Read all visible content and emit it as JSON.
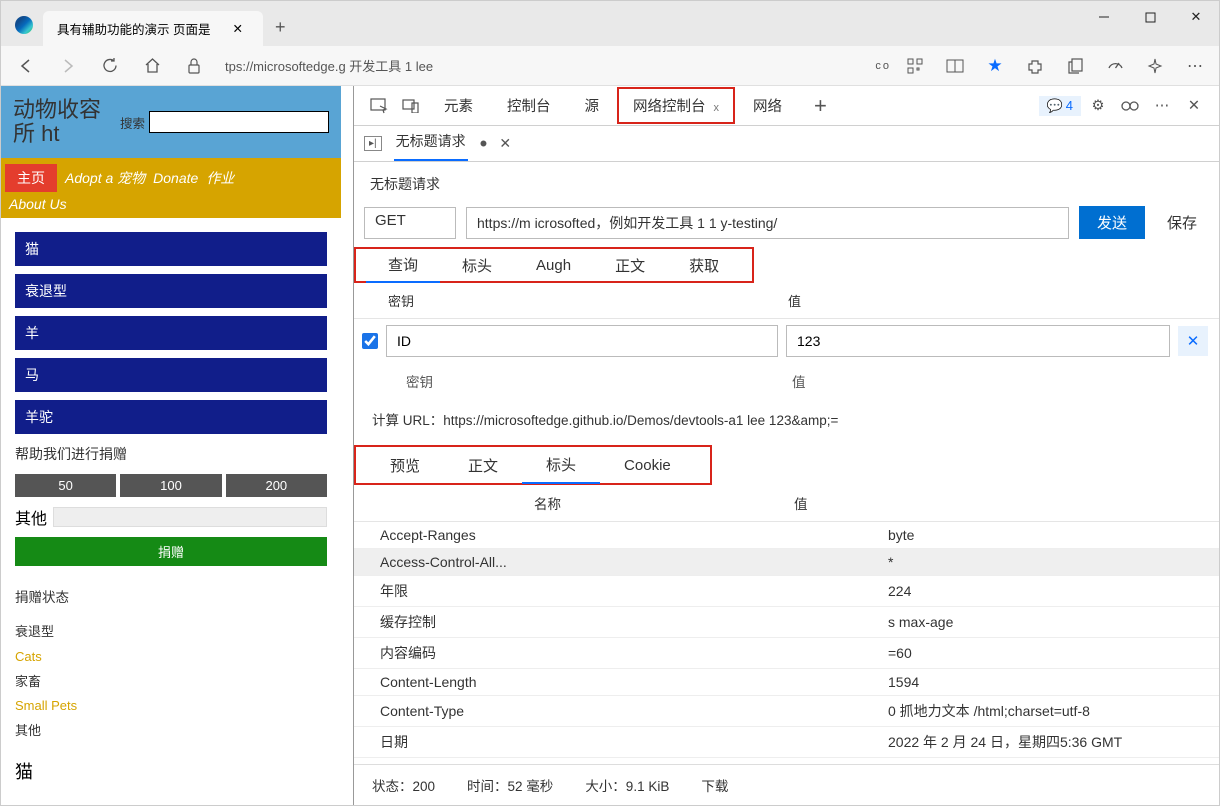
{
  "browser": {
    "tab_title": "具有辅助功能的演示 页面是",
    "url": "tps://microsoftedge.g 开发工具 1 lee",
    "co": "co"
  },
  "page": {
    "logo_line1": "动物收容",
    "logo_line2": "所 ht",
    "search_label": "搜索",
    "nav": {
      "home": "主页",
      "adopt": "Adopt a 宠物",
      "donate": "Donate",
      "jobs": "作业",
      "about": "About Us"
    },
    "categories": [
      "猫",
      "衰退型",
      "羊",
      "马",
      "羊驼"
    ],
    "donate_hdr": "帮助我们进行捐赠",
    "amounts": [
      "50",
      "100",
      "200"
    ],
    "other": "其他",
    "donate_btn": "捐赠",
    "status_hdr": "捐赠状态",
    "statuses": [
      {
        "txt": "衰退型",
        "cls": ""
      },
      {
        "txt": "Cats",
        "cls": "y"
      },
      {
        "txt": "家畜",
        "cls": ""
      },
      {
        "txt": "Small Pets",
        "cls": "y"
      },
      {
        "txt": "其他",
        "cls": ""
      }
    ],
    "big": "猫"
  },
  "devtools": {
    "tabs": [
      "元素",
      "控制台",
      "源",
      "网络控制台",
      "网络"
    ],
    "tab_close": "x",
    "messages": "4",
    "req_tab": "无标题请求",
    "req_title": "无标题请求",
    "method": "GET",
    "url": "https://m icrosofted，例如开发工具 1 1 y-testing/",
    "send": "发送",
    "save": "保存",
    "subtabs": [
      "查询",
      "标头",
      "Augh",
      "正文",
      "获取"
    ],
    "param_key_hdr": "密钥",
    "param_val_hdr": "值",
    "param_key": "ID",
    "param_val": "123",
    "param_key_ph": "密钥",
    "param_val_ph": "值",
    "computed": "计算 URL：https://microsoftedge.github.io/Demos/devtools-a1 lee 123&amp;=",
    "resp_tabs": [
      "预览",
      "正文",
      "标头",
      "Cookie"
    ],
    "headers_name": "名称",
    "headers_val": "值",
    "http_headers": [
      {
        "n": "Accept-Ranges",
        "v": "byte"
      },
      {
        "n": "Access-Control-All...",
        "v": "*"
      },
      {
        "n": "年限",
        "v": "224"
      },
      {
        "n": "缓存控制",
        "v": "s max-age"
      },
      {
        "n": "内容编码",
        "v": "=60"
      },
      {
        "n": "Content-Length",
        "v": "1594"
      },
      {
        "n": "Content-Type",
        "v": "0 抓地力文本 /html;charset=utf-8"
      },
      {
        "n": "日期",
        "v": "2022 年 2 月 24 日，星期四5:36 GMT"
      }
    ],
    "status": {
      "st": "状态：200",
      "time": "时间：52 毫秒",
      "size": "大小：9.1 KiB",
      "dl": "下载"
    }
  }
}
